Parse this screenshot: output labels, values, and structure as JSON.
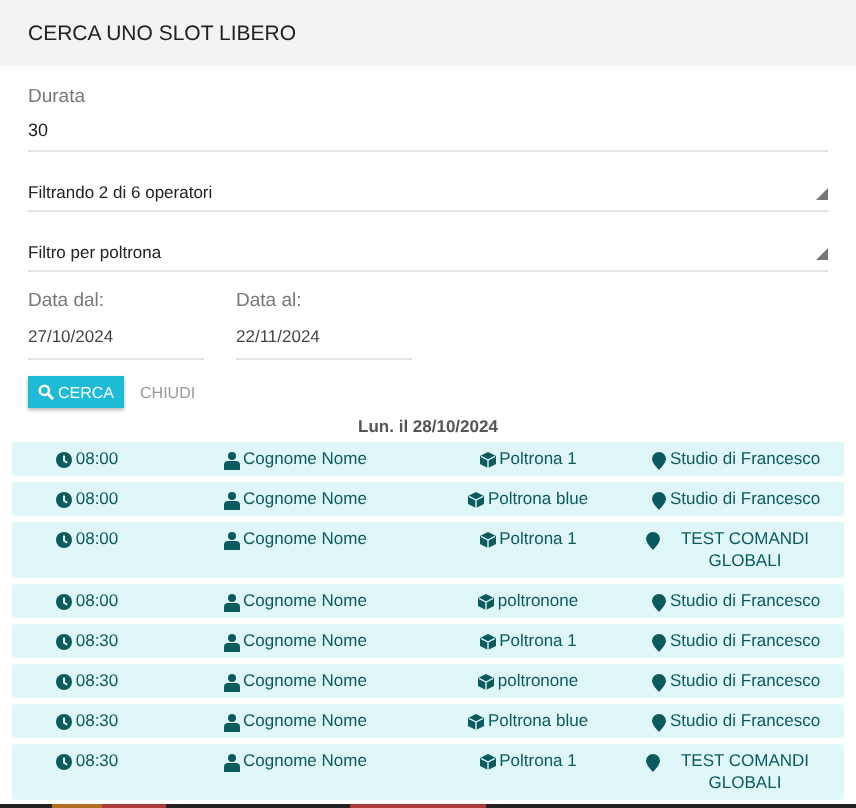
{
  "header": {
    "title": "CERCA UNO SLOT LIBERO"
  },
  "duration": {
    "label": "Durata",
    "value": "30"
  },
  "selects": [
    {
      "value": "Filtrando 2 di 6 operatori"
    },
    {
      "value": "Filtro per poltrona"
    }
  ],
  "dates": [
    {
      "label": "Data dal:",
      "value": "27/10/2024"
    },
    {
      "label": "Data al:",
      "value": "22/11/2024"
    }
  ],
  "buttons": {
    "search": "CERCA",
    "close": "CHIUDI"
  },
  "day": "Lun. il 28/10/2024",
  "slots": [
    {
      "time": "08:00",
      "operator": "Cognome Nome",
      "chair": "Poltrona 1",
      "location": "Studio di Francesco"
    },
    {
      "time": "08:00",
      "operator": "Cognome Nome",
      "chair": "Poltrona blue",
      "location": "Studio di Francesco"
    },
    {
      "time": "08:00",
      "operator": "Cognome Nome",
      "chair": "Poltrona 1",
      "location": "TEST COMANDI GLOBALI"
    },
    {
      "time": "08:00",
      "operator": "Cognome Nome",
      "chair": "poltronone",
      "location": "Studio di Francesco"
    },
    {
      "time": "08:30",
      "operator": "Cognome Nome",
      "chair": "Poltrona 1",
      "location": "Studio di Francesco"
    },
    {
      "time": "08:30",
      "operator": "Cognome Nome",
      "chair": "poltronone",
      "location": "Studio di Francesco"
    },
    {
      "time": "08:30",
      "operator": "Cognome Nome",
      "chair": "Poltrona blue",
      "location": "Studio di Francesco"
    },
    {
      "time": "08:30",
      "operator": "Cognome Nome",
      "chair": "Poltrona 1",
      "location": "TEST COMANDI GLOBALI"
    }
  ]
}
